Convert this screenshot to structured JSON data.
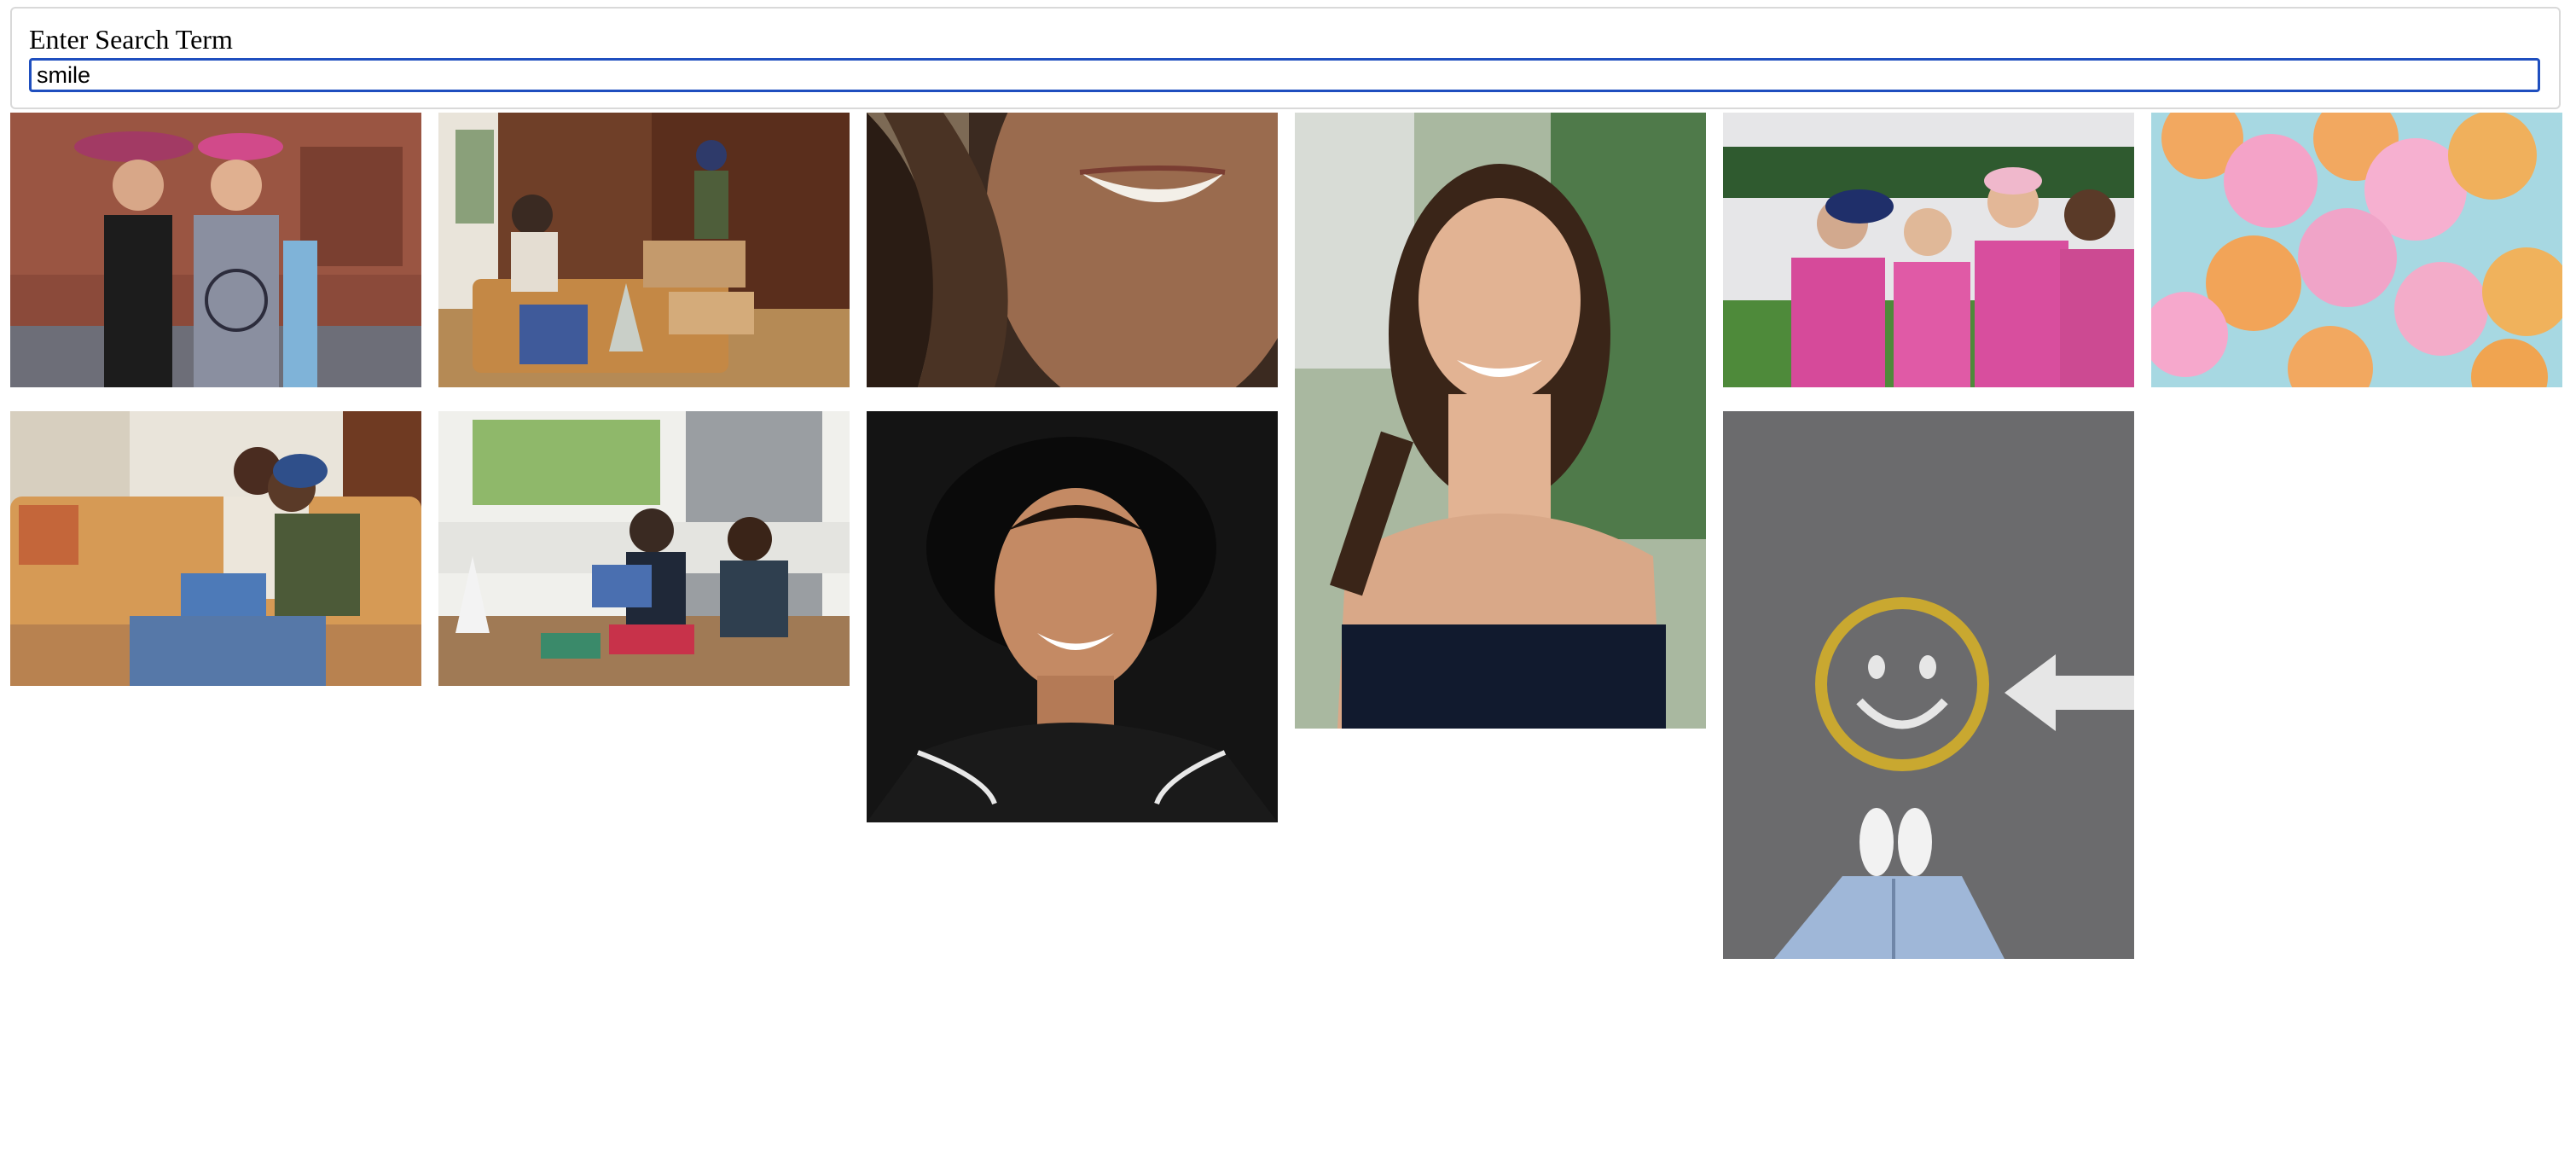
{
  "search": {
    "label": "Enter Search Term",
    "value": "smile"
  },
  "results": [
    {
      "name": "photo-women-pink-hats",
      "icon": "photo-icon"
    },
    {
      "name": "photo-living-room-boxes",
      "icon": "photo-icon"
    },
    {
      "name": "photo-closeup-smile",
      "icon": "photo-icon"
    },
    {
      "name": "photo-laughing-woman",
      "icon": "photo-icon"
    },
    {
      "name": "photo-pink-team-group",
      "icon": "photo-icon"
    },
    {
      "name": "photo-smiley-balloons",
      "icon": "photo-icon"
    },
    {
      "name": "photo-couch-laptop-laughing",
      "icon": "photo-icon"
    },
    {
      "name": "photo-kitchen-table-laptop",
      "icon": "photo-icon"
    },
    {
      "name": "photo-man-black-hat-smiling",
      "icon": "photo-icon"
    },
    {
      "name": "photo-chalk-smiley-arrow",
      "icon": "photo-icon"
    }
  ],
  "colors": {
    "input_border": "#1f4fbf",
    "panel_border": "#d9d9d9"
  }
}
